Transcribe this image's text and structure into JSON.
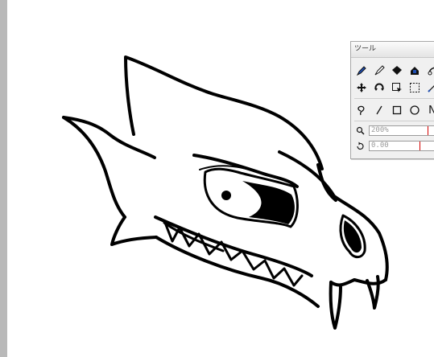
{
  "panel": {
    "title": "ツール",
    "tools_row1": [
      "pen-icon",
      "brush-icon",
      "fill-icon",
      "eraser-icon",
      "gradient-icon"
    ],
    "tools_row2": [
      "move-icon",
      "rotate-icon",
      "select-transform-icon",
      "rect-select-icon",
      "line-pen-icon"
    ],
    "tools_row3": [
      "lasso-icon",
      "line-icon",
      "rectangle-icon",
      "ellipse-icon",
      "text-icon"
    ],
    "text_tool_label": "N",
    "zoom_value": "200%",
    "rotation_value": "0.00"
  },
  "colors": {
    "gutter": "#b9b9b9",
    "panel_bg": "#f0f0f0",
    "panel_border": "#a8a8a8",
    "tool_blue": "#1f4fb3",
    "marker_red": "#d40000"
  }
}
